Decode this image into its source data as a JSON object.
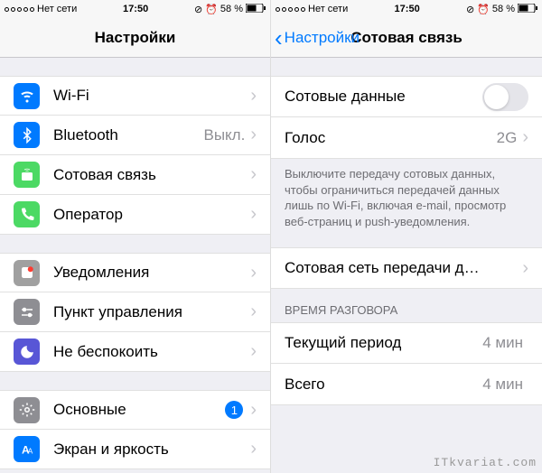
{
  "status": {
    "carrier": "Нет сети",
    "time": "17:50",
    "battery": "58 %"
  },
  "left": {
    "title": "Настройки",
    "rows": {
      "wifi": "Wi-Fi",
      "bluetooth": "Bluetooth",
      "bluetooth_value": "Выкл.",
      "cellular": "Сотовая связь",
      "operator": "Оператор",
      "notifications": "Уведомления",
      "control_center": "Пункт управления",
      "dnd": "Не беспокоить",
      "general": "Основные",
      "general_badge": "1",
      "display": "Экран и яркость"
    }
  },
  "right": {
    "back": "Настройки",
    "title": "Сотовая связь",
    "cell_data": "Сотовые данные",
    "voice": "Голос",
    "voice_value": "2G",
    "footer": "Выключите передачу сотовых данных, чтобы ограничиться передачей данных лишь по Wi-Fi, включая e-mail, просмотр веб-страниц и push-уведомления.",
    "network": "Сотовая сеть передачи д…",
    "section_time": "ВРЕМЯ РАЗГОВОРА",
    "current_period": "Текущий период",
    "current_value": "4 мин",
    "total": "Всего",
    "total_value": "4 мин"
  },
  "watermark": "ITkvariat.com"
}
